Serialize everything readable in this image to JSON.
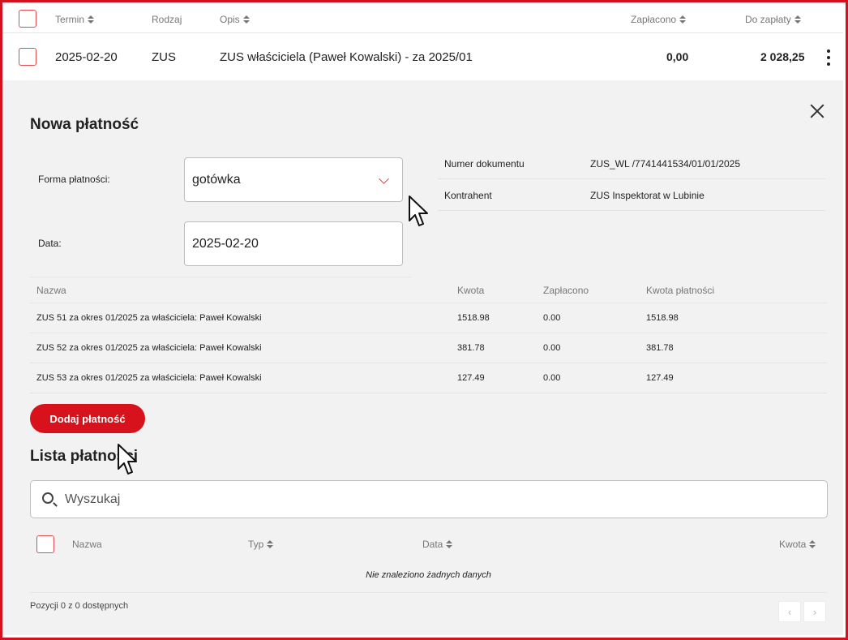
{
  "top_table": {
    "headers": {
      "termin": "Termin",
      "rodzaj": "Rodzaj",
      "opis": "Opis",
      "zaplacono": "Zapłacono",
      "do_zaplaty": "Do zapłaty"
    },
    "row": {
      "termin": "2025-02-20",
      "rodzaj": "ZUS",
      "opis": "ZUS właściciela (Paweł Kowalski) - za 2025/01",
      "zaplacono": "0,00",
      "do_zaplaty": "2 028,25"
    }
  },
  "panel": {
    "title": "Nowa płatność",
    "form": {
      "payment_form_label": "Forma płatności:",
      "payment_form_value": "gotówka",
      "date_label": "Data:",
      "date_value": "2025-02-20"
    },
    "info": {
      "doc_number_label": "Numer dokumentu",
      "doc_number_value": "ZUS_WL /7741441534/01/01/2025",
      "contractor_label": "Kontrahent",
      "contractor_value": "ZUS Inspektorat w Lubinie"
    },
    "items_table": {
      "headers": {
        "nazwa": "Nazwa",
        "kwota": "Kwota",
        "zaplacono": "Zapłacono",
        "kwota_platnosci": "Kwota płatności"
      },
      "rows": [
        {
          "nazwa": "ZUS 51 za okres 01/2025 za właściciela: Paweł Kowalski",
          "kwota": "1518.98",
          "zaplacono": "0.00",
          "kwota_platnosci": "1518.98"
        },
        {
          "nazwa": "ZUS 52 za okres 01/2025 za właściciela: Paweł Kowalski",
          "kwota": "381.78",
          "zaplacono": "0.00",
          "kwota_platnosci": "381.78"
        },
        {
          "nazwa": "ZUS 53 za okres 01/2025 za właściciela: Paweł Kowalski",
          "kwota": "127.49",
          "zaplacono": "0.00",
          "kwota_platnosci": "127.49"
        }
      ]
    },
    "add_button": "Dodaj płatność",
    "list_title": "Lista płatności",
    "search_placeholder": "Wyszukaj",
    "list_headers": {
      "nazwa": "Nazwa",
      "typ": "Typ",
      "data": "Data",
      "kwota": "Kwota"
    },
    "empty_text": "Nie znaleziono żadnych danych",
    "count_text": "Pozycji 0 z 0 dostępnych",
    "pager": {
      "prev": "‹",
      "next": "›"
    }
  },
  "colors": {
    "accent": "#d8121c",
    "frame": "#d4121f",
    "panel_bg": "#f2f2f2"
  }
}
